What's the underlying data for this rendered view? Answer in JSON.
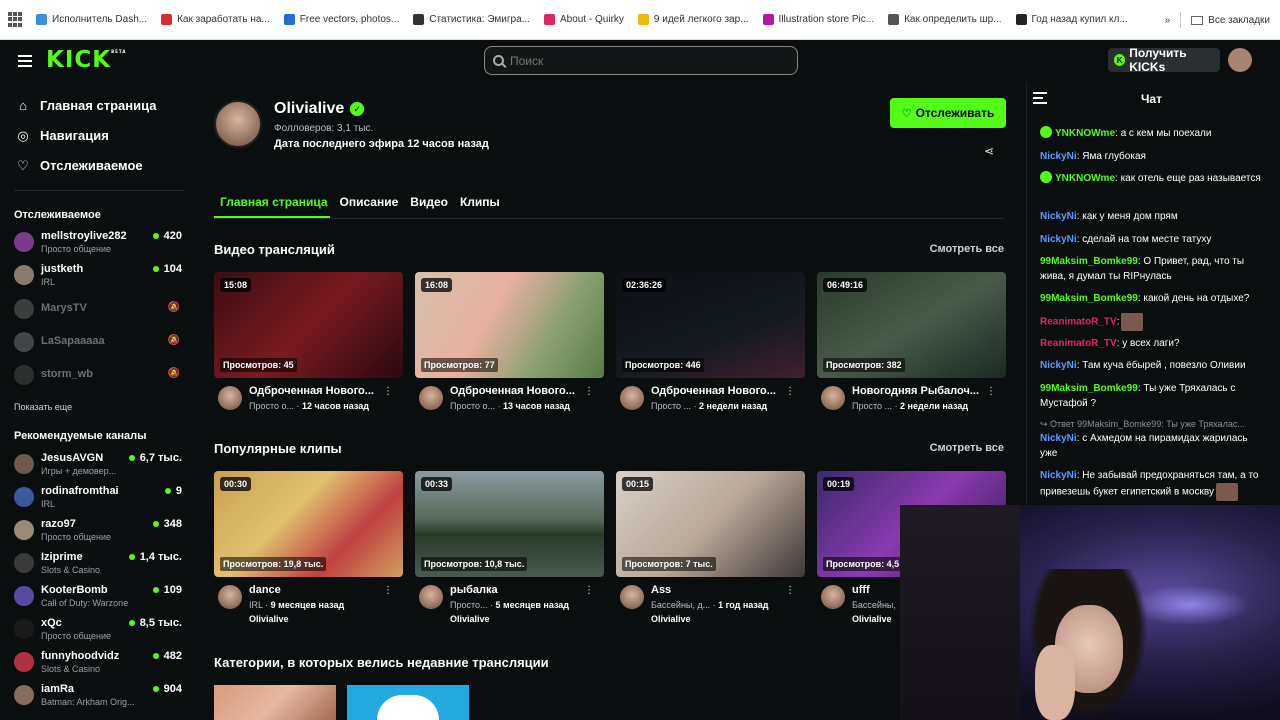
{
  "bookmarks": {
    "items": [
      {
        "label": "Исполнитель Dash...",
        "color": "#3b8ede"
      },
      {
        "label": "Как заработать на...",
        "color": "#d32f2f"
      },
      {
        "label": "Free vectors, photos...",
        "color": "#1e6fd9"
      },
      {
        "label": "Статистика: Эмигра...",
        "color": "#333333"
      },
      {
        "label": "About - Quirky",
        "color": "#e0245e"
      },
      {
        "label": "9 идей легкого зар...",
        "color": "#f2b705"
      },
      {
        "label": "Illustration store Pic...",
        "color": "#b5179e"
      },
      {
        "label": "Как определить шр...",
        "color": "#555555"
      },
      {
        "label": "Год назад купил кл...",
        "color": "#222222"
      }
    ],
    "more": "»",
    "all_bookmarks": "Все закладки"
  },
  "header": {
    "logo": "KICK",
    "logo_badge": "BETA",
    "search_placeholder": "Поиск",
    "get_kicks": "Получить KICKs"
  },
  "sidebar": {
    "nav": [
      {
        "label": "Главная страница",
        "icon": "⌂"
      },
      {
        "label": "Навигация",
        "icon": "◎"
      },
      {
        "label": "Отслеживаемое",
        "icon": "♡"
      }
    ],
    "followed_title": "Отслеживаемое",
    "followed": [
      {
        "name": "mellstroylive282",
        "sub": "Просто общение",
        "viewers": "420",
        "color": "#7a3b8a",
        "live": true
      },
      {
        "name": "justketh",
        "sub": "IRL",
        "viewers": "104",
        "color": "#8a7a70",
        "live": true
      },
      {
        "name": "MarysTV",
        "sub": "",
        "viewers": "",
        "color": "#777777",
        "live": false
      },
      {
        "name": "LaSapaaaaa",
        "sub": "",
        "viewers": "",
        "color": "#888888",
        "live": false
      },
      {
        "name": "storm_wb",
        "sub": "",
        "viewers": "",
        "color": "#555555",
        "live": false
      }
    ],
    "show_more": "Показать еще",
    "recommended_title": "Рекомендуемые каналы",
    "recommended": [
      {
        "name": "JesusAVGN",
        "sub": "Игры + демовер...",
        "viewers": "6,7 тыс.",
        "color": "#6d5a4a"
      },
      {
        "name": "rodinafromthai",
        "sub": "IRL",
        "viewers": "9",
        "color": "#3a5aa0"
      },
      {
        "name": "razo97",
        "sub": "Просто общение",
        "viewers": "348",
        "color": "#9a8a7a"
      },
      {
        "name": "Iziprime",
        "sub": "Slots & Casino",
        "viewers": "1,4 тыс.",
        "color": "#3a3a3a"
      },
      {
        "name": "KooterBomb",
        "sub": "Call of Duty: Warzone",
        "viewers": "109",
        "color": "#5a4aa0"
      },
      {
        "name": "xQc",
        "sub": "Просто общение",
        "viewers": "8,5 тыс.",
        "color": "#1a1a1a"
      },
      {
        "name": "funnyhoodvidz",
        "sub": "Slots & Casino",
        "viewers": "482",
        "color": "#b03040"
      },
      {
        "name": "iamRa",
        "sub": "Batman: Arkham Orig...",
        "viewers": "904",
        "color": "#8a6a5a"
      }
    ]
  },
  "profile": {
    "name": "Olivialive",
    "followers": "Фолловеров: 3,1 тыс.",
    "last_stream": "Дата последнего эфира 12 часов назад",
    "follow_label": "Отслеживать"
  },
  "tabs": [
    "Главная страница",
    "Описание",
    "Видео",
    "Клипы"
  ],
  "videos_section": {
    "title": "Видео трансляций",
    "see_all": "Смотреть все",
    "items": [
      {
        "duration": "15:08",
        "views": "Просмотров: 45",
        "title": "Одброченная Нового...",
        "cat": "Просто о...",
        "ago": "12 часов назад",
        "bg": "linear-gradient(135deg,#3a0d12,#7a1a22 50%,#2a0a10)"
      },
      {
        "duration": "16:08",
        "views": "Просмотров: 77",
        "title": "Одброченная Нового...",
        "cat": "Просто о...",
        "ago": "13 часов назад",
        "bg": "linear-gradient(120deg,#d8c0a8,#e8b0a0 40%,#8aa070 70%,#5a7a4a)"
      },
      {
        "duration": "02:36:26",
        "views": "Просмотров: 446",
        "title": "Одброченная Нового...",
        "cat": "Просто ...",
        "ago": "2 недели назад",
        "bg": "linear-gradient(160deg,#0d0f14,#151a22 60%,#402030)"
      },
      {
        "duration": "06:49:16",
        "views": "Просмотров: 382",
        "title": "Новогодняя Рыбалоч...",
        "cat": "Просто ...",
        "ago": "2 недели назад",
        "bg": "linear-gradient(150deg,#2a3a2a,#4a5a4a 50%,#1a2a22)"
      }
    ]
  },
  "clips_section": {
    "title": "Популярные клипы",
    "see_all": "Смотреть все",
    "items": [
      {
        "duration": "00:30",
        "views": "Просмотров: 19,8 тыс.",
        "title": "dance",
        "cat": "IRL",
        "ago": "9 месяцев назад",
        "owner": "Olivialive",
        "bg": "linear-gradient(135deg,#c8a050,#e0c070 40%,#c04040 70%,#d0a060)"
      },
      {
        "duration": "00:33",
        "views": "Просмотров: 10,8 тыс.",
        "title": "рыбалка",
        "cat": "Просто...",
        "ago": "5 месяцев назад",
        "owner": "Olivialive",
        "bg": "linear-gradient(180deg,#8a9aa0,#5a6a5a 45%,#2a3a2a 60%,#4a5a50)"
      },
      {
        "duration": "00:15",
        "views": "Просмотров: 7 тыс.",
        "title": "Ass",
        "cat": "Бассейны, д...",
        "ago": "1 год назад",
        "owner": "Olivialive",
        "bg": "linear-gradient(135deg,#d8d0c8,#b8a898 50%,#403838)"
      },
      {
        "duration": "00:19",
        "views": "Просмотров: 4,5",
        "title": "ufff",
        "cat": "Бассейны,",
        "ago": "",
        "owner": "Olivialive",
        "bg": "linear-gradient(135deg,#3a2a6a,#8a3ab0 50%,#2a1a4a)"
      }
    ]
  },
  "categories_title": "Категории, в которых велись недавние трансляции",
  "chat": {
    "title": "Чат",
    "messages": [
      {
        "user": "YNKNOWme",
        "color": "#53fc18",
        "badge": true,
        "text": ": а с кем мы поехали",
        "emote": false
      },
      {
        "user": "NickyNi",
        "color": "#5a9cff",
        "badge": false,
        "text": ": Яма глубокая",
        "emote": false
      },
      {
        "user": "YNKNOWme",
        "color": "#53fc18",
        "badge": true,
        "text": ": как отель еще раз называется",
        "emote": false
      },
      {
        "user": "NickyNi",
        "color": "#5a9cff",
        "badge": false,
        "text": ": как у меня дом прям",
        "emote": false
      },
      {
        "user": "NickyNi",
        "color": "#5a9cff",
        "badge": false,
        "text": ": сделай на том месте татуху",
        "emote": false
      },
      {
        "user": "99Maksim_Bomke99",
        "color": "#53fc18",
        "badge": false,
        "text": ": О Привет, рад, что ты жива, я думал ты RIPнулась",
        "emote": false
      },
      {
        "user": "99Maksim_Bomke99",
        "color": "#53fc18",
        "badge": false,
        "text": ": какой день на отдыхе?",
        "emote": false
      },
      {
        "user": "ReanimatoR_TV",
        "color": "#e0245e",
        "badge": false,
        "text": ":",
        "emote": true
      },
      {
        "user": "ReanimatoR_TV",
        "color": "#e0245e",
        "badge": false,
        "text": ": у всех лаги?",
        "emote": false
      },
      {
        "user": "NickyNi",
        "color": "#5a9cff",
        "badge": false,
        "text": ": Там куча ёбырей , повезло Оливии",
        "emote": false
      },
      {
        "user": "99Maksim_Bomke99",
        "color": "#53fc18",
        "badge": false,
        "text": ": Ты уже Тряхалась с Мустафой ?",
        "emote": false
      },
      {
        "user": "NickyNi",
        "color": "#5a9cff",
        "badge": false,
        "text": ": с Ахмедом на пирамидах жарилась уже",
        "emote": false
      },
      {
        "user": "NickyNi",
        "color": "#5a9cff",
        "badge": false,
        "text": ": Не забывай предохраняться там, а то привезешь букет египетский в москву",
        "emote": true
      }
    ],
    "reply_note": "↪ Ответ 99Maksim_Bomke99: Ты уже Тряхалас..."
  }
}
